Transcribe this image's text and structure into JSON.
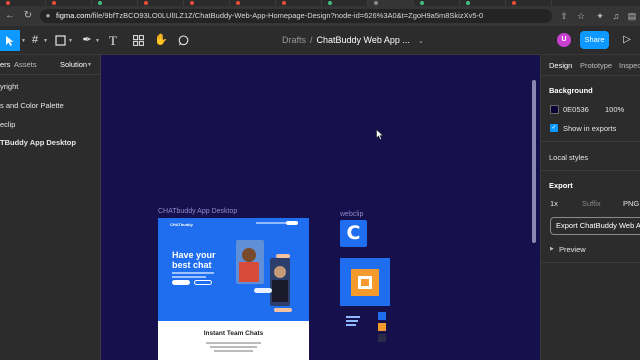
{
  "browser": {
    "url_host": "figma.com",
    "url_path": "/file/9bfTzBCO93LO0LUlILZ1Z/ChatBuddy-Web-App-Homepage-Design?node-id=626%3A0&t=ZgoH9a5m8SkizXv5-0"
  },
  "toolbar": {
    "breadcrumb_parent": "Drafts",
    "breadcrumb_sep": "/",
    "file_name": "ChatBuddy Web App ...",
    "avatar_initial": "U",
    "share_label": "Share"
  },
  "left_panel": {
    "tab_layers": "ers",
    "tab_assets": "Assets",
    "tab_page": "Solution",
    "items": [
      "yright",
      "s and Color Palette",
      "eclip",
      "TBuddy App Desktop"
    ]
  },
  "right_panel": {
    "tabs": [
      "Design",
      "Prototype",
      "Inspect"
    ],
    "background_title": "Background",
    "bg_hex": "0E0536",
    "bg_opacity": "100%",
    "show_in_exports": "Show in exports",
    "local_styles": "Local styles",
    "export_title": "Export",
    "export_scale": "1x",
    "export_suffix": "Suffix",
    "export_format": "PNG",
    "export_button": "Export ChatBuddy Web App",
    "preview": "Preview"
  },
  "canvas": {
    "frame1_label": "CHATbuddy App Desktop",
    "frame2_label": "webclip",
    "site_logo": "CHATbuddy",
    "hero_title_line1": "Have your",
    "hero_title_line2": "best chat",
    "section_title": "Instant Team Chats",
    "webclip_letter": "C"
  },
  "colors": {
    "canvas_bg": "#16104c",
    "accent_blue": "#0d99ff",
    "site_blue": "#1f6ef0",
    "orange": "#f59a2c",
    "avatar": "#c93fd1"
  }
}
